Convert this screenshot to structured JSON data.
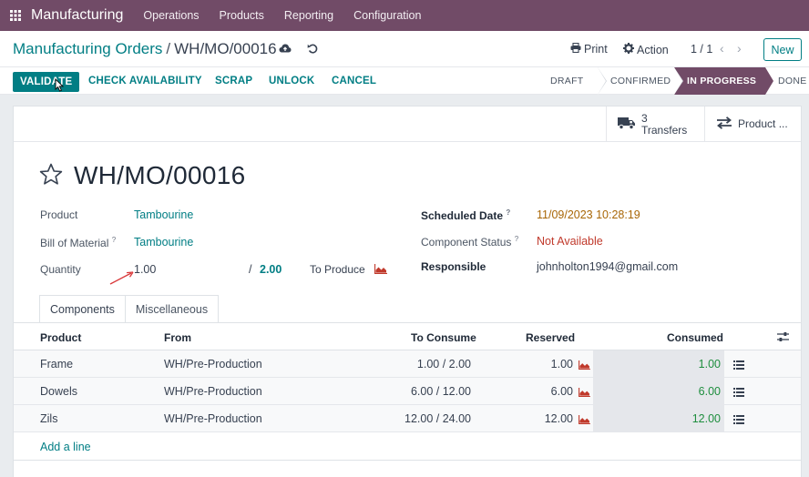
{
  "nav": {
    "app_name": "Manufacturing",
    "menu": [
      "Operations",
      "Products",
      "Reporting",
      "Configuration"
    ]
  },
  "control": {
    "breadcrumb_parent": "Manufacturing Orders",
    "breadcrumb_sep": "/",
    "breadcrumb_current": "WH/MO/00016",
    "print_label": "Print",
    "action_label": "Action",
    "pager": "1 / 1",
    "new_label": "New"
  },
  "actions": {
    "validate": "VALIDATE",
    "check_availability": "CHECK AVAILABILITY",
    "scrap": "SCRAP",
    "unlock": "UNLOCK",
    "cancel": "CANCEL"
  },
  "stages": [
    "DRAFT",
    "CONFIRMED",
    "IN PROGRESS",
    "DONE"
  ],
  "active_stage": "IN PROGRESS",
  "smart_buttons": {
    "transfers_count": "3",
    "transfers_label": "Transfers",
    "product_label": "Product ..."
  },
  "form": {
    "title": "WH/MO/00016",
    "product_label": "Product",
    "product_value": "Tambourine",
    "bom_label": "Bill of Material",
    "bom_value": "Tambourine",
    "quantity_label": "Quantity",
    "quantity_value": "1.00",
    "quantity_sep": "/",
    "quantity_total": "2.00",
    "to_produce_label": "To Produce",
    "scheduled_label": "Scheduled Date",
    "scheduled_value": "11/09/2023 10:28:19",
    "component_status_label": "Component Status",
    "component_status_value": "Not Available",
    "responsible_label": "Responsible",
    "responsible_value": "johnholton1994@gmail.com",
    "help_mark": "?"
  },
  "tabs": [
    "Components",
    "Miscellaneous"
  ],
  "table": {
    "headers": [
      "Product",
      "From",
      "To Consume",
      "Reserved",
      "Consumed"
    ],
    "rows": [
      {
        "product": "Frame",
        "from": "WH/Pre-Production",
        "to_consume": "1.00 /  2.00",
        "reserved": "1.00",
        "consumed": "1.00"
      },
      {
        "product": "Dowels",
        "from": "WH/Pre-Production",
        "to_consume": "6.00 /  12.00",
        "reserved": "6.00",
        "consumed": "6.00"
      },
      {
        "product": "Zils",
        "from": "WH/Pre-Production",
        "to_consume": "12.00 /  24.00",
        "reserved": "12.00",
        "consumed": "12.00"
      }
    ],
    "add_line": "Add a line"
  },
  "colors": {
    "brand": "#714b67",
    "accent": "#017e84",
    "consumed_green": "#1e8e3e",
    "not_available_red": "#c0392b",
    "date_orange": "#a86606",
    "forecast_icon_red": "#c0392b",
    "annotation_arrow": "#d9383a"
  },
  "icons": [
    "apps-grid-icon",
    "cloud-upload-icon",
    "undo-icon",
    "print-icon",
    "gear-icon",
    "chevron-left-icon",
    "chevron-right-icon",
    "truck-icon",
    "transfer-arrows-icon",
    "star-icon",
    "forecast-chart-icon",
    "list-details-icon",
    "optional-columns-icon",
    "mouse-cursor-icon",
    "annotation-arrow-icon"
  ]
}
